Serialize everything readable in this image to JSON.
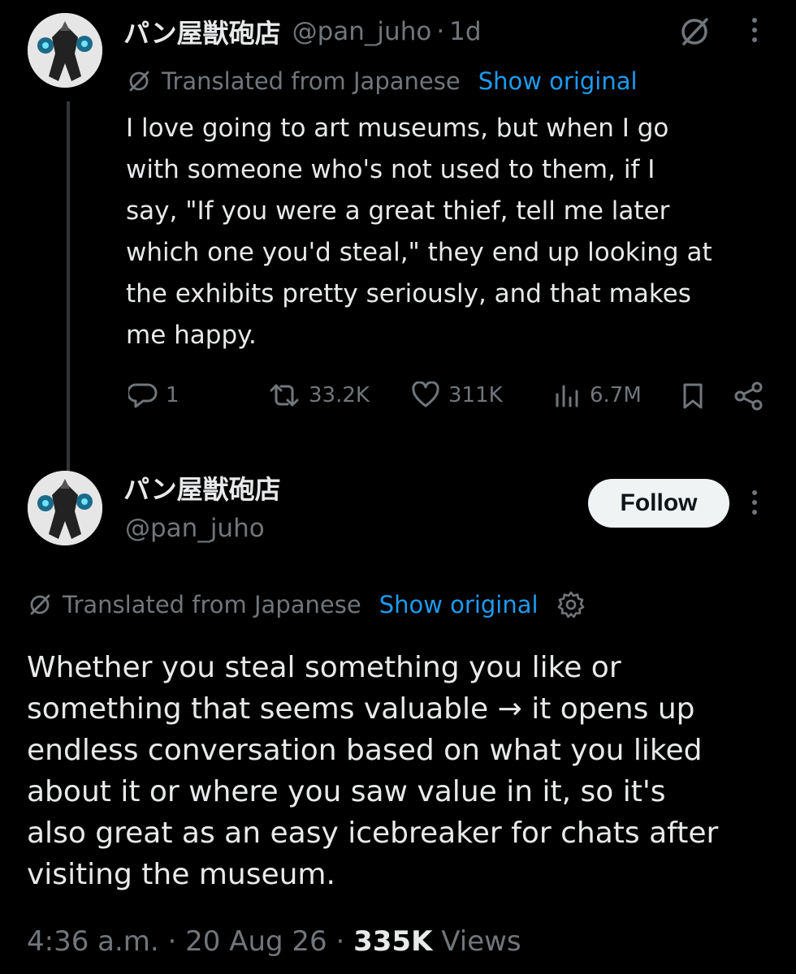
{
  "reply_tweet": {
    "display_name": "パン屋獣砲店",
    "handle": "@pan_juho",
    "separator": "·",
    "time_ago": "1d",
    "translated_label": "Translated from Japanese",
    "show_original": "Show original",
    "text": "I love going to art museums, but when I go\nwith someone who's not used to them, if I\nsay, \"If you were a great thief, tell me later\nwhich one you'd steal,\" they end up looking at\nthe exhibits pretty seriously, and that makes\nme happy.",
    "metrics": {
      "replies": "1",
      "reposts": "33.2K",
      "likes": "311K",
      "views": "6.7M"
    }
  },
  "main_tweet": {
    "display_name": "パン屋獣砲店",
    "handle": "@pan_juho",
    "follow_label": "Follow",
    "translated_label": "Translated from Japanese",
    "show_original": "Show original",
    "text": "Whether you steal something you like or\nsomething that seems valuable → it opens up\nendless conversation based on what you liked\nabout it or where you saw value in it, so it's\nalso great as an easy icebreaker for chats after\nvisiting the museum.",
    "timestamp": "4:36 a.m. · 20 Aug 26 · ",
    "views_count": "335K",
    "views_label": " Views"
  },
  "colors": {
    "background": "#000000",
    "text_primary": "#e7e9ea",
    "text_secondary": "#71767b",
    "link": "#1d9bf0",
    "button_bg": "#eff3f4"
  },
  "icons": {
    "translate": "slashed-circle-icon",
    "more": "more-vertical-icon",
    "reply": "reply-icon",
    "repost": "repost-icon",
    "like": "heart-icon",
    "views": "views-bar-chart-icon",
    "bookmark": "bookmark-icon",
    "share": "share-icon",
    "settings": "gear-icon"
  }
}
